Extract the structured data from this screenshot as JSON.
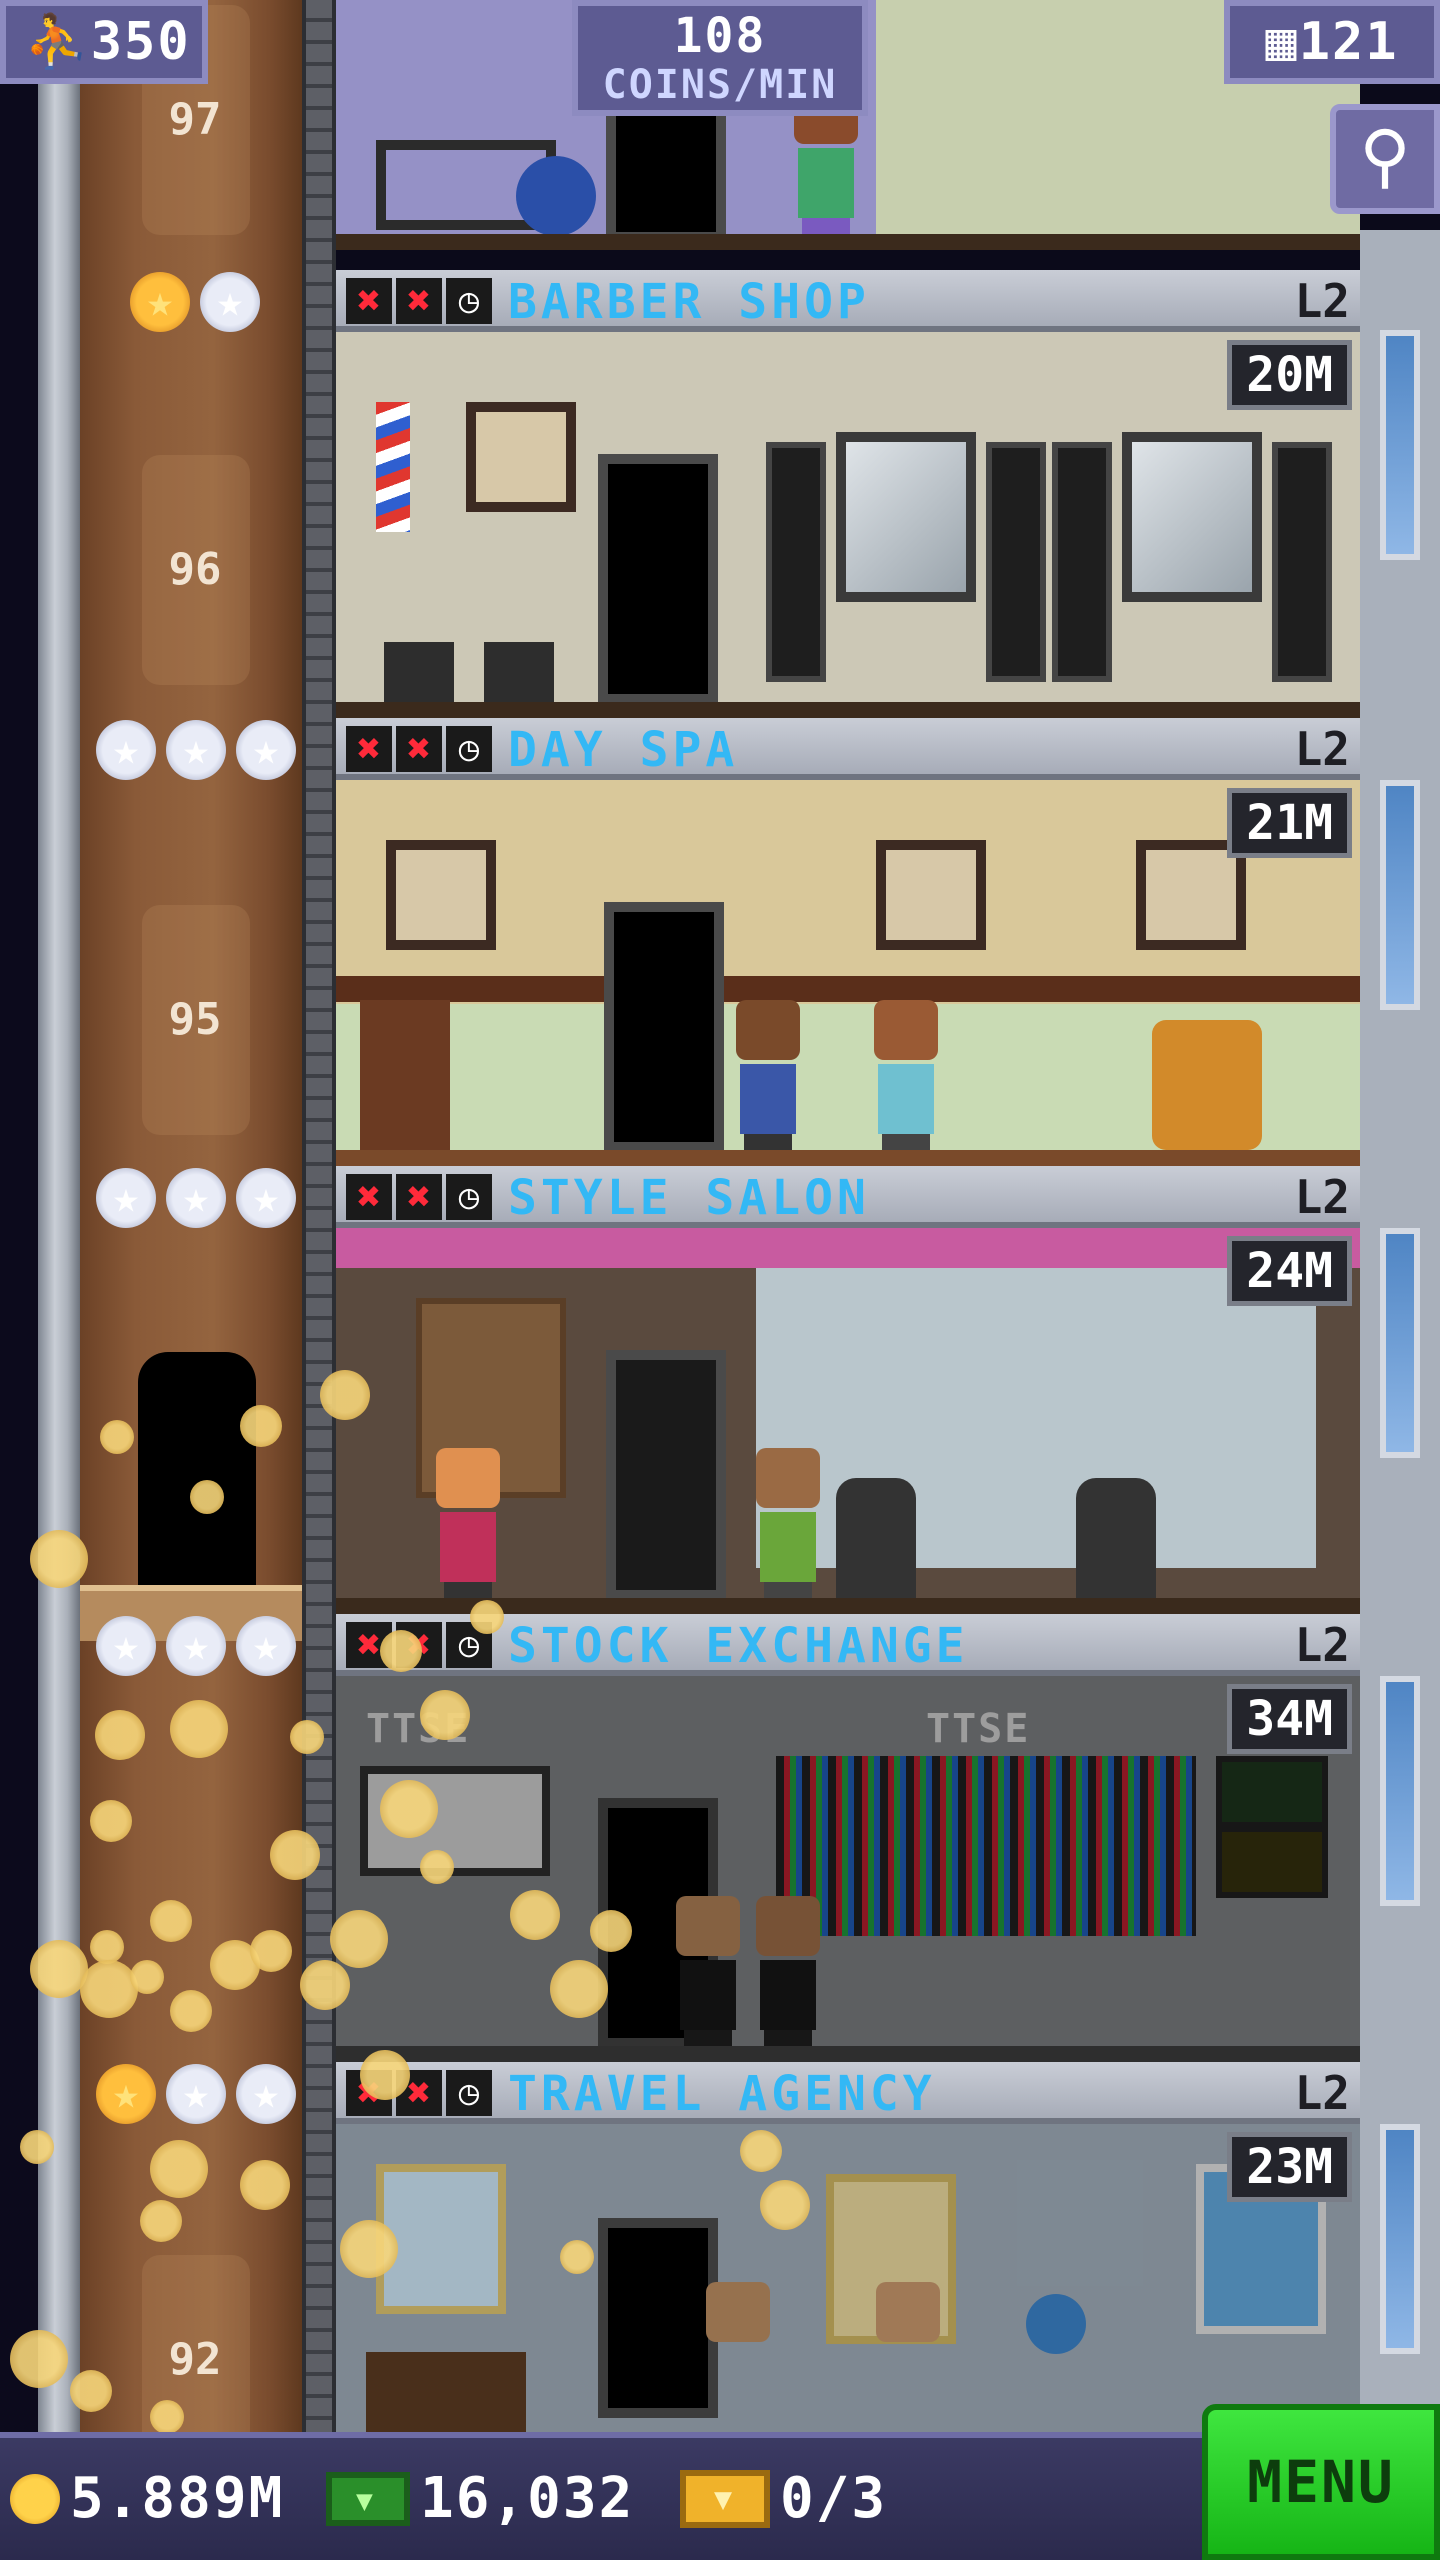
{
  "hud": {
    "population": "350",
    "coins_per_min_value": "108",
    "coins_per_min_unit": "COINS/MIN",
    "floors": "121"
  },
  "shaft": {
    "floor_numbers": [
      "97",
      "96",
      "95",
      "92"
    ]
  },
  "floors": [
    {
      "name": "BARBER SHOP",
      "level": "L2",
      "value": "20M",
      "stars_gold": 1,
      "stars_total": 2
    },
    {
      "name": "DAY SPA",
      "level": "L2",
      "value": "21M",
      "stars_gold": 0,
      "stars_total": 3
    },
    {
      "name": "STYLE SALON",
      "level": "L2",
      "value": "24M",
      "stars_gold": 0,
      "stars_total": 3
    },
    {
      "name": "STOCK EXCHANGE",
      "level": "L2",
      "value": "34M",
      "stars_gold": 0,
      "stars_total": 3
    },
    {
      "name": "TRAVEL AGENCY",
      "level": "L2",
      "value": "23M",
      "stars_gold": 1,
      "stars_total": 3
    }
  ],
  "stock_signs": [
    "TTSE",
    "TTSE"
  ],
  "bottom_bar": {
    "coins": "5.889M",
    "bux": "16,032",
    "tickets": "0/3",
    "menu_label": "MENU"
  },
  "icons": {
    "population": "person-icon",
    "floors": "building-icon",
    "search": "magnifier-icon",
    "coins": "coin-icon",
    "bux": "bux-icon",
    "tickets": "ticket-icon"
  },
  "colors": {
    "floor_name": "#33b8f5",
    "menu_button": "#2ecf2e",
    "hud_panel": "#5d5b92",
    "status_x": "#ff2a3a"
  }
}
